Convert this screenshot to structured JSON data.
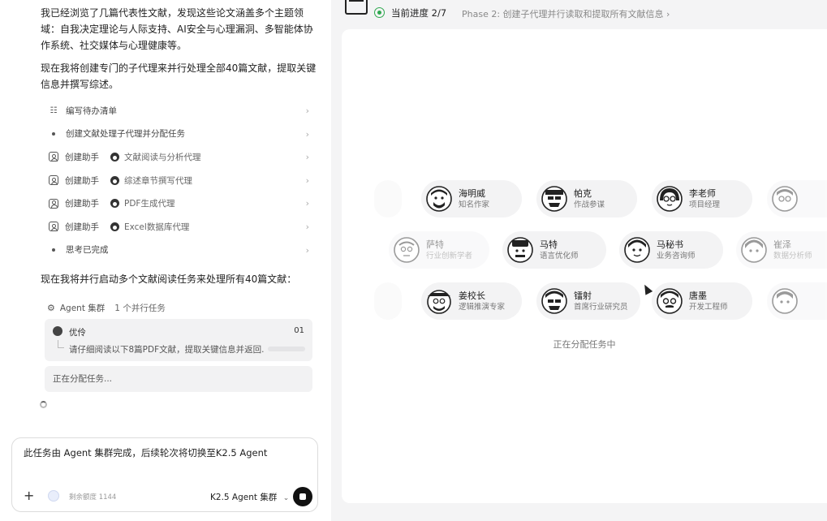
{
  "chat": {
    "para1": "我已经浏览了几篇代表性文献，发现这些论文涵盖多个主题领域：自我决定理论与人际支持、AI安全与心理漏洞、多智能体协作系统、社交媒体与心理健康等。",
    "para2": "现在我将创建专门的子代理来并行处理全部40篇文献，提取关键信息并撰写综述。",
    "steps": [
      {
        "icon": "checklist-icon",
        "label": "编写待办清单"
      },
      {
        "icon": "dot",
        "label": "创建文献处理子代理并分配任务"
      },
      {
        "icon": "person-icon",
        "label": "创建助手",
        "agent": "文献阅读与分析代理"
      },
      {
        "icon": "person-icon",
        "label": "创建助手",
        "agent": "综述章节撰写代理"
      },
      {
        "icon": "person-icon",
        "label": "创建助手",
        "agent": "PDF生成代理"
      },
      {
        "icon": "person-icon",
        "label": "创建助手",
        "agent": "Excel数据库代理"
      },
      {
        "icon": "dot",
        "label": "思考已完成"
      }
    ],
    "para3": "现在我将并行启动多个文献阅读任务来处理所有40篇文献：",
    "swarm": {
      "title": "Agent 集群",
      "count": "1 个并行任务",
      "task_name": "优伶",
      "task_num": "01",
      "task_desc": "请仔细阅读以下8篇PDF文献，提取关键信息并返回...",
      "assigning": "正在分配任务..."
    },
    "input": {
      "message": "此任务由 Agent 集群完成，后续轮次将切换至K2.5 Agent",
      "remaining": "剩余额度 1144",
      "model": "K2.5 Agent 集群"
    }
  },
  "progress": {
    "label": "当前进度 2/7",
    "phase": "Phase 2: 创建子代理并行读取和提取所有文献信息"
  },
  "agents": {
    "row1": [
      {
        "name": "海明威",
        "role": "知名作家"
      },
      {
        "name": "帕克",
        "role": "作战参谋"
      },
      {
        "name": "李老师",
        "role": "项目经理"
      }
    ],
    "row2": [
      {
        "name": "萨特",
        "role": "行业创新学者"
      },
      {
        "name": "马特",
        "role": "语言优化师"
      },
      {
        "name": "马秘书",
        "role": "业务咨询师"
      },
      {
        "name": "崔泽",
        "role": "数据分析师"
      }
    ],
    "row3": [
      {
        "name": "姜校长",
        "role": "逻辑推演专家"
      },
      {
        "name": "镭射",
        "role": "首席行业研究员"
      },
      {
        "name": "唐墨",
        "role": "开发工程师"
      }
    ],
    "status": "正在分配任务中"
  }
}
